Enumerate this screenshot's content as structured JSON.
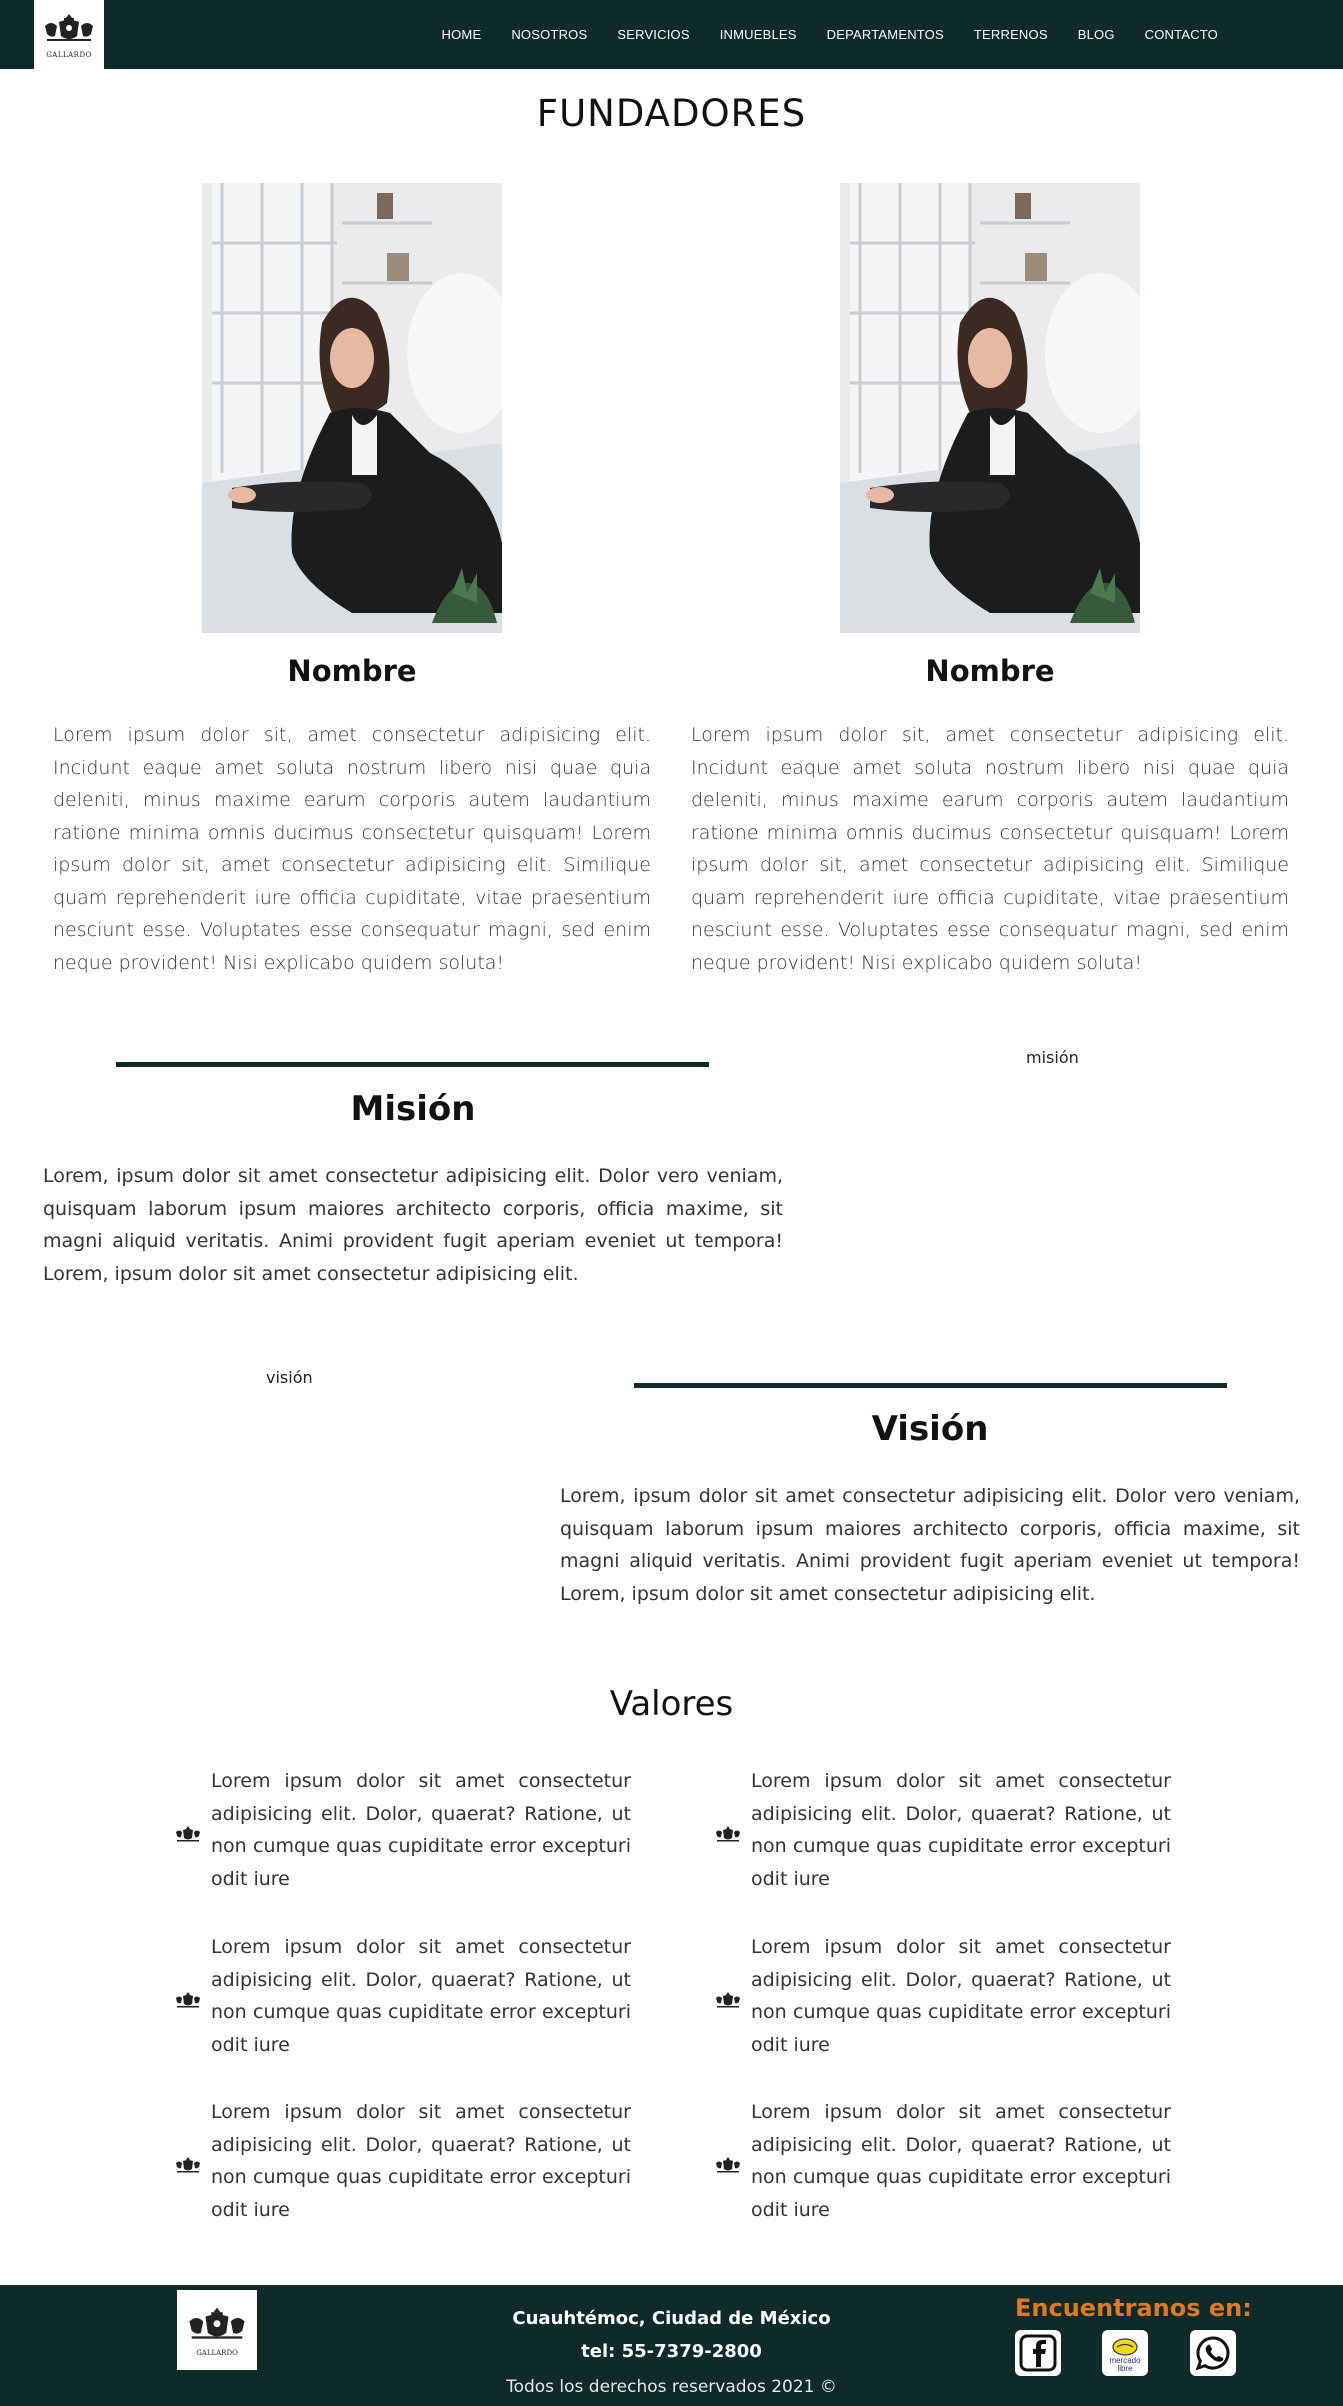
{
  "nav": {
    "logo_text": "GALLARDO",
    "items": [
      "HOME",
      "NOSOTROS",
      "SERVICIOS",
      "INMUEBLES",
      "DEPARTAMENTOS",
      "TERRENOS",
      "BLOG",
      "CONTACTO"
    ]
  },
  "fundadores": {
    "title": "FUNDADORES",
    "people": [
      {
        "name": "Nombre",
        "bio": "Lorem ipsum dolor sit, amet consectetur adipisicing elit. Incidunt eaque amet soluta nostrum libero nisi quae quia deleniti, minus maxime earum corporis autem laudantium ratione minima omnis ducimus consectetur quisquam! Lorem ipsum dolor sit, amet consectetur adipisicing elit. Similique quam reprehenderit iure officia cupiditate, vitae praesentium nesciunt esse. Voluptates esse consequatur magni, sed enim neque provident! Nisi explicabo quidem soluta!"
      },
      {
        "name": "Nombre",
        "bio": "Lorem ipsum dolor sit, amet consectetur adipisicing elit. Incidunt eaque amet soluta nostrum libero nisi quae quia deleniti, minus maxime earum corporis autem laudantium ratione minima omnis ducimus consectetur quisquam! Lorem ipsum dolor sit, amet consectetur adipisicing elit. Similique quam reprehenderit iure officia cupiditate, vitae praesentium nesciunt esse. Voluptates esse consequatur magni, sed enim neque provident! Nisi explicabo quidem soluta!"
      }
    ]
  },
  "mision": {
    "image_alt": "misión",
    "title": "Misión",
    "text": "Lorem, ipsum dolor sit amet consectetur adipisicing elit. Dolor vero veniam, quisquam laborum ipsum maiores architecto corporis, officia maxime, sit magni aliquid veritatis. Animi provident fugit aperiam eveniet ut tempora! Lorem, ipsum dolor sit amet consectetur adipisicing elit."
  },
  "vision": {
    "image_alt": "visión",
    "title": "Visión",
    "text": "Lorem, ipsum dolor sit amet consectetur adipisicing elit. Dolor vero veniam, quisquam laborum ipsum maiores architecto corporis, officia maxime, sit magni aliquid veritatis. Animi provident fugit aperiam eveniet ut tempora! Lorem, ipsum dolor sit amet consectetur adipisicing elit."
  },
  "valores": {
    "title": "Valores",
    "items": [
      "Lorem ipsum dolor sit amet consectetur adipisicing elit. Dolor, quaerat? Ratione, ut non cumque quas cupiditate error excepturi odit iure",
      "Lorem ipsum dolor sit amet consectetur adipisicing elit. Dolor, quaerat? Ratione, ut non cumque quas cupiditate error excepturi odit iure",
      "Lorem ipsum dolor sit amet consectetur adipisicing elit. Dolor, quaerat? Ratione, ut non cumque quas cupiditate error excepturi odit iure",
      "Lorem ipsum dolor sit amet consectetur adipisicing elit. Dolor, quaerat? Ratione, ut non cumque quas cupiditate error excepturi odit iure",
      "Lorem ipsum dolor sit amet consectetur adipisicing elit. Dolor, quaerat? Ratione, ut non cumque quas cupiditate error excepturi odit iure",
      "Lorem ipsum dolor sit amet consectetur adipisicing elit. Dolor, quaerat? Ratione, ut non cumque quas cupiditate error excepturi odit iure"
    ]
  },
  "footer": {
    "logo_text": "GALLARDO",
    "address": "Cuauhtémoc, Ciudad de México",
    "phone": "tel: 55-7379-2800",
    "copyright": "Todos los derechos reservados 2021 ©",
    "social_title": "Encuentranos en:",
    "mercado_label_1": "mercado",
    "mercado_label_2": "libre",
    "social_icons": [
      "facebook-icon",
      "mercado-libre-icon",
      "whatsapp-icon"
    ]
  },
  "colors": {
    "brand_dark": "#0e2b2a",
    "accent_orange": "#e07a22"
  }
}
